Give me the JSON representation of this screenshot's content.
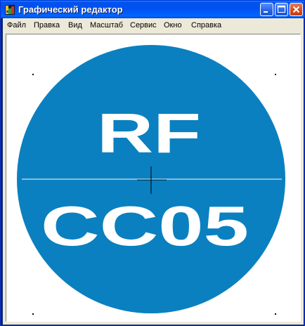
{
  "window": {
    "title": "Графический редактор"
  },
  "menu": {
    "items": [
      "Файл",
      "Правка",
      "Вид",
      "Масштаб",
      "Сервис",
      "Окно",
      "Справка"
    ]
  },
  "drawing": {
    "circle_color": "#0a80c0",
    "text_color": "#ffffff",
    "line_color": "#ffffff",
    "top_text": "RF",
    "bottom_text": "CC05",
    "crosshair_icon": "crosshair-cursor"
  }
}
